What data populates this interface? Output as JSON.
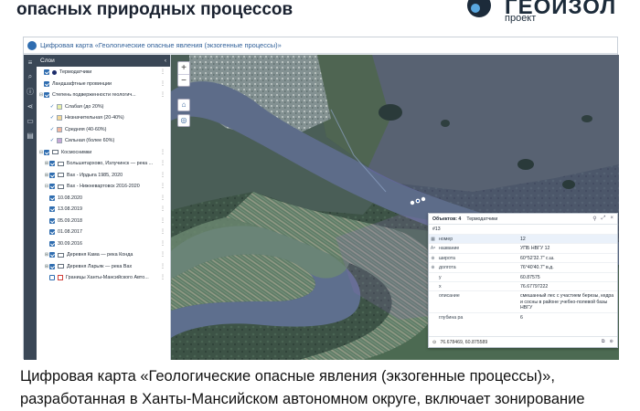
{
  "slide": {
    "title": "опасных природных процессов",
    "logo": {
      "word": "ГЕОИЗОЛ",
      "sub": "проект"
    },
    "caption_lines": [
      "Цифровая карта «Геологические опасные явления (экзогенные процессы)»,",
      "разработанная в Ханты-Мансийском  автономном округе, включает зонирование"
    ]
  },
  "app": {
    "title": "Цифровая карта «Геологические опасные явления (экзогенные процессы)»",
    "rail_icons": [
      "layers-icon",
      "search-icon",
      "info-icon",
      "share-icon",
      "print-icon",
      "document-icon"
    ],
    "layers_panel": {
      "header": "Слои",
      "close_glyph": "‹",
      "items": [
        {
          "label": "Термодатчики",
          "kind": "dot",
          "checked": true
        },
        {
          "label": "Ландшафтные провинции",
          "kind": "plain",
          "checked": true
        },
        {
          "label": "Степень подверженности геологич...",
          "kind": "group",
          "checked": true,
          "expanded": true
        },
        {
          "label": "Слабая (до 20%)",
          "kind": "legend",
          "color": "#e9f0a8"
        },
        {
          "label": "Незначительная (20-40%)",
          "kind": "legend",
          "color": "#f4d99a"
        },
        {
          "label": "Средняя (40-60%)",
          "kind": "legend",
          "color": "#f3b7a0"
        },
        {
          "label": "Сильная (более 60%)",
          "kind": "legend",
          "color": "#c7a7d6"
        },
        {
          "label": "Космоснимки",
          "kind": "folder",
          "checked": true,
          "expanded": true
        },
        {
          "label": "Большетархово, Излучинск — река ...",
          "kind": "folder",
          "checked": true
        },
        {
          "label": "Вах - Ирдыга 1985, 2020",
          "kind": "folder",
          "checked": true
        },
        {
          "label": "Вах - Нижневартовск 2016-2020",
          "kind": "folder",
          "checked": true,
          "expanded": true
        },
        {
          "label": "10.08.2020",
          "kind": "date",
          "checked": true
        },
        {
          "label": "13.08.2019",
          "kind": "date",
          "checked": true
        },
        {
          "label": "05.09.2018",
          "kind": "date",
          "checked": true
        },
        {
          "label": "01.08.2017",
          "kind": "date",
          "checked": true
        },
        {
          "label": "30.09.2016",
          "kind": "date",
          "checked": true
        },
        {
          "label": "Деревня Кама — река Конда",
          "kind": "folder",
          "checked": true
        },
        {
          "label": "Деревня Ларьяк — река Вах",
          "kind": "folder",
          "checked": true
        },
        {
          "label": "Границы Ханты-Мансийского Авто...",
          "kind": "boundary",
          "checked": false
        }
      ]
    },
    "map_controls": {
      "zoom_in": "+",
      "zoom_out": "−"
    },
    "popup": {
      "objects_label": "Объектов: 4",
      "layer_name": "Термодатчики",
      "record_id": "#13",
      "rows": [
        {
          "icon": "grid-icon",
          "key": "номер",
          "value": "12"
        },
        {
          "icon": "text-icon",
          "key": "название",
          "value": "УПБ НВГУ 12"
        },
        {
          "icon": "globe-icon",
          "key": "широта",
          "value": "60°52'32.7\" с.ш."
        },
        {
          "icon": "globe-icon",
          "key": "долгота",
          "value": "76°40'40.7\" в.д."
        },
        {
          "icon": "",
          "key": "y",
          "value": "60.87575"
        },
        {
          "icon": "",
          "key": "x",
          "value": "76.67797222"
        },
        {
          "icon": "",
          "key": "описание",
          "value": "смешанный лес с участием березы, кедра и сосны в районе учебно-полевой базы НВГУ"
        },
        {
          "icon": "",
          "key": "глубина ра",
          "value": "6"
        }
      ],
      "coordinates": "76.678469, 60.875589"
    }
  }
}
